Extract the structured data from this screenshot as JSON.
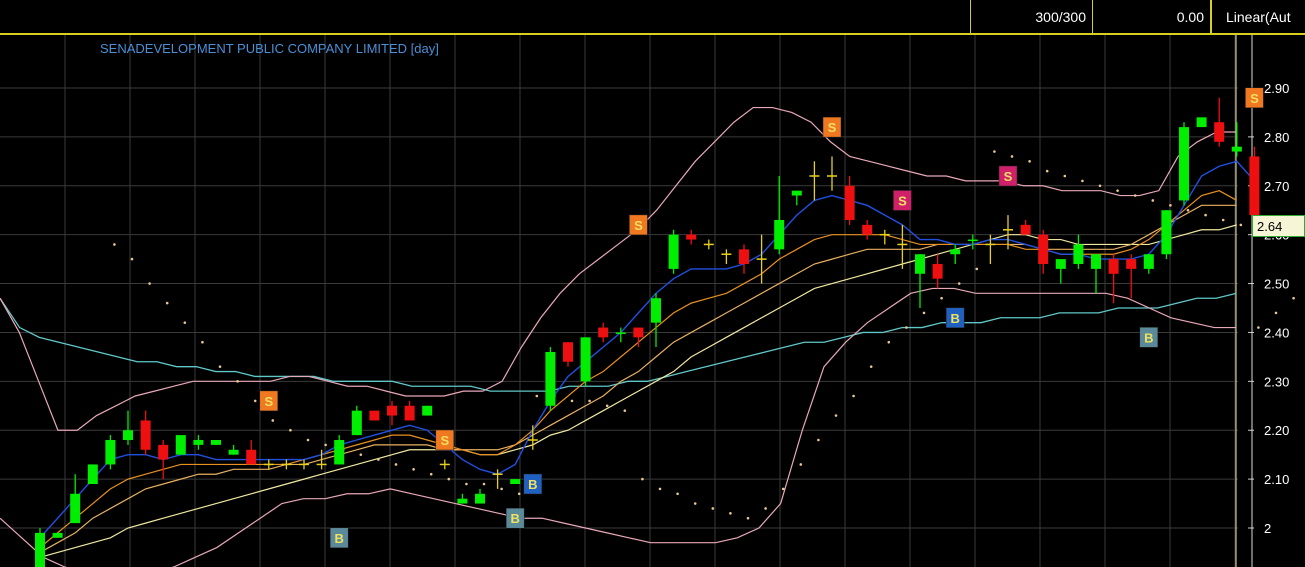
{
  "header": {
    "count_label": "300/300",
    "value_label": "0.00",
    "scale_label": "Linear(Aut"
  },
  "current_price_label": "2.64",
  "chart_data": {
    "type": "candlestick",
    "title": "SENADEVELOPMENT PUBLIC COMPANY LIMITED [day]",
    "ylim": [
      1.9,
      2.98
    ],
    "y_ticks": [
      "2",
      "2.10",
      "2.20",
      "2.30",
      "2.40",
      "2.50",
      "2.60",
      "2.70",
      "2.80",
      "2.90"
    ],
    "y_tick_values": [
      2.0,
      2.1,
      2.2,
      2.3,
      2.4,
      2.5,
      2.6,
      2.7,
      2.8,
      2.9
    ],
    "grid": true,
    "candles": [
      {
        "o": 1.92,
        "h": 2.0,
        "l": 1.92,
        "c": 1.99
      },
      {
        "o": 1.98,
        "h": 1.99,
        "l": 1.98,
        "c": 1.99
      },
      {
        "o": 2.01,
        "h": 2.11,
        "l": 2.01,
        "c": 2.07
      },
      {
        "o": 2.09,
        "h": 2.13,
        "l": 2.09,
        "c": 2.13
      },
      {
        "o": 2.13,
        "h": 2.19,
        "l": 2.12,
        "c": 2.18
      },
      {
        "o": 2.18,
        "h": 2.24,
        "l": 2.17,
        "c": 2.2
      },
      {
        "o": 2.22,
        "h": 2.24,
        "l": 2.15,
        "c": 2.16
      },
      {
        "o": 2.17,
        "h": 2.18,
        "l": 2.1,
        "c": 2.14
      },
      {
        "o": 2.15,
        "h": 2.19,
        "l": 2.15,
        "c": 2.19
      },
      {
        "o": 2.17,
        "h": 2.19,
        "l": 2.16,
        "c": 2.18
      },
      {
        "o": 2.17,
        "h": 2.18,
        "l": 2.17,
        "c": 2.18
      },
      {
        "o": 2.15,
        "h": 2.17,
        "l": 2.15,
        "c": 2.16
      },
      {
        "o": 2.16,
        "h": 2.18,
        "l": 2.13,
        "c": 2.13
      },
      {
        "o": 2.13,
        "h": 2.14,
        "l": 2.12,
        "c": 2.13,
        "color": "yellow"
      },
      {
        "o": 2.13,
        "h": 2.14,
        "l": 2.12,
        "c": 2.13,
        "color": "yellow"
      },
      {
        "o": 2.13,
        "h": 2.14,
        "l": 2.12,
        "c": 2.13,
        "color": "yellow"
      },
      {
        "o": 2.13,
        "h": 2.16,
        "l": 2.12,
        "c": 2.13,
        "color": "yellow"
      },
      {
        "o": 2.13,
        "h": 2.19,
        "l": 2.13,
        "c": 2.18
      },
      {
        "o": 2.19,
        "h": 2.25,
        "l": 2.19,
        "c": 2.24
      },
      {
        "o": 2.24,
        "h": 2.24,
        "l": 2.22,
        "c": 2.22
      },
      {
        "o": 2.25,
        "h": 2.26,
        "l": 2.21,
        "c": 2.23
      },
      {
        "o": 2.25,
        "h": 2.26,
        "l": 2.22,
        "c": 2.22
      },
      {
        "o": 2.23,
        "h": 2.25,
        "l": 2.23,
        "c": 2.25
      },
      {
        "o": 2.13,
        "h": 2.14,
        "l": 2.12,
        "c": 2.13,
        "color": "yellow"
      },
      {
        "o": 2.05,
        "h": 2.07,
        "l": 2.05,
        "c": 2.06
      },
      {
        "o": 2.05,
        "h": 2.08,
        "l": 2.05,
        "c": 2.07
      },
      {
        "o": 2.11,
        "h": 2.12,
        "l": 2.08,
        "c": 2.11,
        "color": "yellow"
      },
      {
        "o": 2.09,
        "h": 2.1,
        "l": 2.09,
        "c": 2.1
      },
      {
        "o": 2.17,
        "h": 2.21,
        "l": 2.16,
        "c": 2.18,
        "color": "yellow"
      },
      {
        "o": 2.25,
        "h": 2.37,
        "l": 2.24,
        "c": 2.36
      },
      {
        "o": 2.38,
        "h": 2.38,
        "l": 2.33,
        "c": 2.34
      },
      {
        "o": 2.3,
        "h": 2.39,
        "l": 2.29,
        "c": 2.39
      },
      {
        "o": 2.41,
        "h": 2.42,
        "l": 2.38,
        "c": 2.39
      },
      {
        "o": 2.4,
        "h": 2.41,
        "l": 2.38,
        "c": 2.4
      },
      {
        "o": 2.41,
        "h": 2.41,
        "l": 2.37,
        "c": 2.39
      },
      {
        "o": 2.42,
        "h": 2.48,
        "l": 2.37,
        "c": 2.47
      },
      {
        "o": 2.53,
        "h": 2.61,
        "l": 2.52,
        "c": 2.6
      },
      {
        "o": 2.6,
        "h": 2.61,
        "l": 2.58,
        "c": 2.59
      },
      {
        "o": 2.58,
        "h": 2.59,
        "l": 2.57,
        "c": 2.58,
        "color": "yellow"
      },
      {
        "o": 2.56,
        "h": 2.57,
        "l": 2.54,
        "c": 2.56,
        "color": "yellow"
      },
      {
        "o": 2.57,
        "h": 2.58,
        "l": 2.52,
        "c": 2.54
      },
      {
        "o": 2.55,
        "h": 2.6,
        "l": 2.5,
        "c": 2.55,
        "color": "yellow"
      },
      {
        "o": 2.57,
        "h": 2.72,
        "l": 2.56,
        "c": 2.63
      },
      {
        "o": 2.68,
        "h": 2.69,
        "l": 2.66,
        "c": 2.69
      },
      {
        "o": 2.72,
        "h": 2.75,
        "l": 2.67,
        "c": 2.72,
        "color": "yellow"
      },
      {
        "o": 2.72,
        "h": 2.76,
        "l": 2.69,
        "c": 2.72,
        "color": "yellow"
      },
      {
        "o": 2.7,
        "h": 2.72,
        "l": 2.62,
        "c": 2.63
      },
      {
        "o": 2.62,
        "h": 2.63,
        "l": 2.59,
        "c": 2.6
      },
      {
        "o": 2.6,
        "h": 2.61,
        "l": 2.58,
        "c": 2.6,
        "color": "yellow"
      },
      {
        "o": 2.58,
        "h": 2.62,
        "l": 2.53,
        "c": 2.58,
        "color": "yellow"
      },
      {
        "o": 2.52,
        "h": 2.56,
        "l": 2.45,
        "c": 2.56
      },
      {
        "o": 2.54,
        "h": 2.56,
        "l": 2.49,
        "c": 2.51
      },
      {
        "o": 2.56,
        "h": 2.58,
        "l": 2.54,
        "c": 2.57
      },
      {
        "o": 2.59,
        "h": 2.6,
        "l": 2.57,
        "c": 2.59
      },
      {
        "o": 2.58,
        "h": 2.6,
        "l": 2.54,
        "c": 2.58,
        "color": "yellow"
      },
      {
        "o": 2.6,
        "h": 2.64,
        "l": 2.57,
        "c": 2.61,
        "color": "yellow"
      },
      {
        "o": 2.62,
        "h": 2.63,
        "l": 2.6,
        "c": 2.6
      },
      {
        "o": 2.6,
        "h": 2.61,
        "l": 2.52,
        "c": 2.54
      },
      {
        "o": 2.53,
        "h": 2.55,
        "l": 2.5,
        "c": 2.55
      },
      {
        "o": 2.54,
        "h": 2.6,
        "l": 2.53,
        "c": 2.58
      },
      {
        "o": 2.53,
        "h": 2.56,
        "l": 2.48,
        "c": 2.56
      },
      {
        "o": 2.55,
        "h": 2.56,
        "l": 2.46,
        "c": 2.52
      },
      {
        "o": 2.55,
        "h": 2.56,
        "l": 2.47,
        "c": 2.53
      },
      {
        "o": 2.53,
        "h": 2.56,
        "l": 2.52,
        "c": 2.56
      },
      {
        "o": 2.56,
        "h": 2.65,
        "l": 2.55,
        "c": 2.65
      },
      {
        "o": 2.67,
        "h": 2.83,
        "l": 2.66,
        "c": 2.82
      },
      {
        "o": 2.82,
        "h": 2.84,
        "l": 2.83,
        "c": 2.84
      },
      {
        "o": 2.83,
        "h": 2.88,
        "l": 2.78,
        "c": 2.79
      },
      {
        "o": 2.77,
        "h": 2.83,
        "l": 2.76,
        "c": 2.78
      },
      {
        "o": 2.76,
        "h": 2.78,
        "l": 2.64,
        "c": 2.64
      }
    ],
    "candle_x_start": 40,
    "candle_x_step": 17.6,
    "sar": [
      2.58,
      2.55,
      2.5,
      2.46,
      2.42,
      2.38,
      2.33,
      2.3,
      2.26,
      2.22,
      2.2,
      2.18,
      2.17,
      2.16,
      2.15,
      2.14,
      2.13,
      2.12,
      2.11,
      2.1,
      2.09,
      2.09,
      2.08,
      2.07,
      2.27,
      2.27,
      2.26,
      2.26,
      2.25,
      2.24,
      2.1,
      2.08,
      2.07,
      2.05,
      2.04,
      2.03,
      2.02,
      2.04,
      2.08,
      2.13,
      2.18,
      2.23,
      2.27,
      2.33,
      2.38,
      2.41,
      2.44,
      2.47,
      2.5,
      2.53,
      2.77,
      2.76,
      2.75,
      2.73,
      2.72,
      2.71,
      2.7,
      2.69,
      2.68,
      2.67,
      2.66,
      2.65,
      2.64,
      2.63,
      2.62,
      2.41,
      2.44,
      2.47,
      2.49,
      2.52
    ],
    "ema_fast": [
      1.98,
      2.02,
      2.06,
      2.1,
      2.14,
      2.15,
      2.15,
      2.14,
      2.15,
      2.15,
      2.14,
      2.14,
      2.14,
      2.14,
      2.14,
      2.14,
      2.15,
      2.17,
      2.18,
      2.19,
      2.2,
      2.21,
      2.2,
      2.17,
      2.14,
      2.12,
      2.11,
      2.13,
      2.2,
      2.26,
      2.31,
      2.34,
      2.37,
      2.4,
      2.44,
      2.48,
      2.51,
      2.53,
      2.53,
      2.53,
      2.54,
      2.56,
      2.6,
      2.64,
      2.67,
      2.68,
      2.67,
      2.66,
      2.64,
      2.62,
      2.59,
      2.59,
      2.58,
      2.58,
      2.59,
      2.59,
      2.58,
      2.57,
      2.56,
      2.56,
      2.55,
      2.55,
      2.55,
      2.56,
      2.6,
      2.66,
      2.72,
      2.74,
      2.75,
      2.71
    ],
    "ema_mid": [
      1.96,
      1.99,
      2.02,
      2.05,
      2.08,
      2.1,
      2.11,
      2.12,
      2.13,
      2.13,
      2.13,
      2.13,
      2.13,
      2.13,
      2.13,
      2.14,
      2.15,
      2.16,
      2.17,
      2.18,
      2.19,
      2.19,
      2.18,
      2.17,
      2.16,
      2.15,
      2.15,
      2.17,
      2.2,
      2.24,
      2.27,
      2.3,
      2.32,
      2.35,
      2.38,
      2.41,
      2.44,
      2.46,
      2.47,
      2.48,
      2.5,
      2.52,
      2.55,
      2.57,
      2.59,
      2.6,
      2.6,
      2.6,
      2.6,
      2.59,
      2.58,
      2.58,
      2.58,
      2.58,
      2.58,
      2.58,
      2.57,
      2.57,
      2.56,
      2.56,
      2.56,
      2.56,
      2.57,
      2.59,
      2.62,
      2.65,
      2.68,
      2.69,
      2.67
    ],
    "ema_slow": [
      1.95,
      1.97,
      1.99,
      2.02,
      2.04,
      2.06,
      2.08,
      2.09,
      2.1,
      2.11,
      2.11,
      2.12,
      2.12,
      2.12,
      2.13,
      2.13,
      2.14,
      2.15,
      2.16,
      2.17,
      2.17,
      2.17,
      2.17,
      2.16,
      2.16,
      2.16,
      2.16,
      2.17,
      2.19,
      2.21,
      2.23,
      2.25,
      2.27,
      2.3,
      2.32,
      2.35,
      2.38,
      2.4,
      2.42,
      2.44,
      2.46,
      2.48,
      2.5,
      2.52,
      2.54,
      2.55,
      2.56,
      2.57,
      2.57,
      2.57,
      2.57,
      2.58,
      2.58,
      2.58,
      2.58,
      2.58,
      2.58,
      2.57,
      2.57,
      2.57,
      2.57,
      2.57,
      2.58,
      2.6,
      2.62,
      2.64,
      2.66,
      2.66,
      2.66
    ],
    "ma_long": [
      1.94,
      1.95,
      1.96,
      1.97,
      1.98,
      2.0,
      2.01,
      2.02,
      2.03,
      2.04,
      2.05,
      2.06,
      2.07,
      2.08,
      2.09,
      2.1,
      2.11,
      2.12,
      2.13,
      2.14,
      2.15,
      2.16,
      2.16,
      2.16,
      2.16,
      2.15,
      2.15,
      2.16,
      2.17,
      2.19,
      2.2,
      2.22,
      2.24,
      2.26,
      2.28,
      2.3,
      2.32,
      2.35,
      2.37,
      2.39,
      2.41,
      2.43,
      2.45,
      2.47,
      2.49,
      2.5,
      2.51,
      2.52,
      2.53,
      2.54,
      2.55,
      2.56,
      2.57,
      2.58,
      2.59,
      2.6,
      2.6,
      2.59,
      2.59,
      2.58,
      2.58,
      2.58,
      2.58,
      2.58,
      2.59,
      2.6,
      2.61,
      2.61,
      2.62
    ],
    "ma_200": [
      2.47,
      2.41,
      2.39,
      2.38,
      2.37,
      2.36,
      2.35,
      2.34,
      2.34,
      2.33,
      2.33,
      2.32,
      2.32,
      2.31,
      2.31,
      2.31,
      2.31,
      2.3,
      2.3,
      2.3,
      2.3,
      2.29,
      2.29,
      2.29,
      2.29,
      2.28,
      2.28,
      2.28,
      2.28,
      2.29,
      2.29,
      2.29,
      2.3,
      2.3,
      2.31,
      2.32,
      2.33,
      2.34,
      2.35,
      2.36,
      2.37,
      2.38,
      2.38,
      2.39,
      2.4,
      2.4,
      2.41,
      2.41,
      2.42,
      2.42,
      2.42,
      2.43,
      2.43,
      2.43,
      2.44,
      2.44,
      2.44,
      2.45,
      2.45,
      2.45,
      2.46,
      2.47,
      2.47,
      2.48
    ],
    "bb_upper": [
      2.47,
      2.4,
      2.3,
      2.2,
      2.2,
      2.23,
      2.25,
      2.27,
      2.28,
      2.29,
      2.3,
      2.3,
      2.3,
      2.3,
      2.3,
      2.31,
      2.31,
      2.3,
      2.29,
      2.29,
      2.28,
      2.27,
      2.27,
      2.27,
      2.28,
      2.28,
      2.3,
      2.37,
      2.43,
      2.48,
      2.52,
      2.55,
      2.58,
      2.61,
      2.65,
      2.7,
      2.75,
      2.79,
      2.83,
      2.86,
      2.86,
      2.85,
      2.83,
      2.79,
      2.76,
      2.75,
      2.74,
      2.73,
      2.72,
      2.72,
      2.71,
      2.71,
      2.71,
      2.7,
      2.7,
      2.69,
      2.69,
      2.69,
      2.68,
      2.68,
      2.69,
      2.76,
      2.79,
      2.81,
      2.81
    ],
    "bb_lower": [
      2.02,
      1.98,
      1.94,
      1.92,
      1.91,
      1.9,
      1.9,
      1.91,
      1.92,
      1.94,
      1.96,
      1.99,
      2.02,
      2.05,
      2.06,
      2.06,
      2.07,
      2.07,
      2.08,
      2.07,
      2.06,
      2.05,
      2.04,
      2.03,
      2.02,
      2.02,
      2.01,
      2.0,
      1.99,
      1.98,
      1.97,
      1.97,
      1.97,
      1.97,
      1.98,
      2.0,
      2.05,
      2.2,
      2.33,
      2.38,
      2.42,
      2.45,
      2.48,
      2.49,
      2.49,
      2.48,
      2.48,
      2.48,
      2.48,
      2.48,
      2.48,
      2.48,
      2.47,
      2.45,
      2.43,
      2.42,
      2.41,
      2.41
    ],
    "signals": [
      {
        "label": "S",
        "candle": 13,
        "price": 2.26,
        "color": "#f07820"
      },
      {
        "label": "B",
        "candle": 17,
        "price": 1.98,
        "color": "#5a8a9a"
      },
      {
        "label": "S",
        "candle": 23,
        "price": 2.18,
        "color": "#f07820"
      },
      {
        "label": "B",
        "candle": 27,
        "price": 2.02,
        "color": "#5a8a9a"
      },
      {
        "label": "B",
        "candle": 28,
        "price": 2.09,
        "color": "#2060c0"
      },
      {
        "label": "S",
        "candle": 34,
        "price": 2.62,
        "color": "#f07820"
      },
      {
        "label": "S",
        "candle": 45,
        "price": 2.82,
        "color": "#f07820"
      },
      {
        "label": "S",
        "candle": 49,
        "price": 2.67,
        "color": "#d0206a"
      },
      {
        "label": "B",
        "candle": 52,
        "price": 2.43,
        "color": "#2060c0"
      },
      {
        "label": "S",
        "candle": 55,
        "price": 2.72,
        "color": "#d0206a"
      },
      {
        "label": "B",
        "candle": 63,
        "price": 2.39,
        "color": "#5a8a9a"
      },
      {
        "label": "S",
        "candle": 69,
        "price": 2.88,
        "color": "#f07820"
      }
    ],
    "colors": {
      "up": "#00ee00",
      "down": "#ee1010",
      "flat": "#e8d020",
      "grid": "#3a3a3a",
      "sar": "#e8c890",
      "ema_fast": "#2050e0",
      "ema_mid": "#e89020",
      "ema_slow": "#e8b060",
      "ma_long": "#f0e8a0",
      "ma_200": "#60c8c8",
      "bb": "#e8a8b8",
      "axis_text": "#ffffff"
    }
  }
}
